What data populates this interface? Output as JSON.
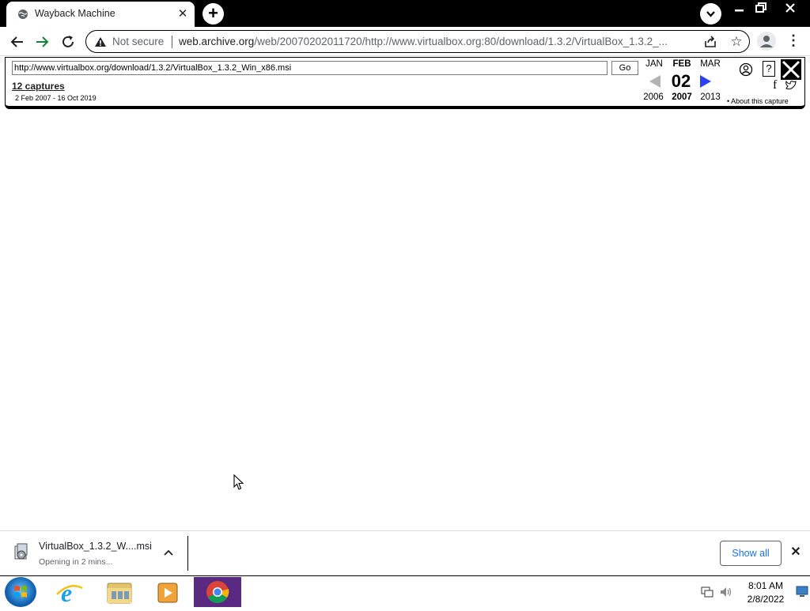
{
  "browser": {
    "tab_title": "Wayback Machine",
    "tab_close": "✕",
    "new_tab": "+",
    "not_secure": "Not secure",
    "url_host": "web.archive.org",
    "url_path": "/web/20070202011720/http://www.virtualbox.org:80/download/1.3.2/VirtualBox_1.3.2_...",
    "menu": "⋮",
    "star": "☆"
  },
  "wayback": {
    "url_value": "http://www.virtualbox.org/download/1.3.2/VirtualBox_1.3.2_Win_x86.msi",
    "go_label": "Go",
    "captures": "12 captures",
    "range": "2 Feb 2007 - 16 Oct 2019",
    "months": {
      "prev": "JAN",
      "current": "FEB",
      "next": "MAR"
    },
    "day": "02",
    "years": {
      "prev": "2006",
      "current": "2007",
      "next": "2013"
    },
    "help": "?",
    "facebook": "f",
    "about": "• About this capture"
  },
  "download": {
    "filename": "VirtualBox_1.3.2_W....msi",
    "status": "Opening in 2 mins...",
    "show_all": "Show all",
    "close": "✕"
  },
  "taskbar": {
    "time": "8:01 AM",
    "date": "2/8/2022",
    "items": [
      "internet-explorer",
      "file-explorer",
      "media-player",
      "chrome"
    ]
  }
}
